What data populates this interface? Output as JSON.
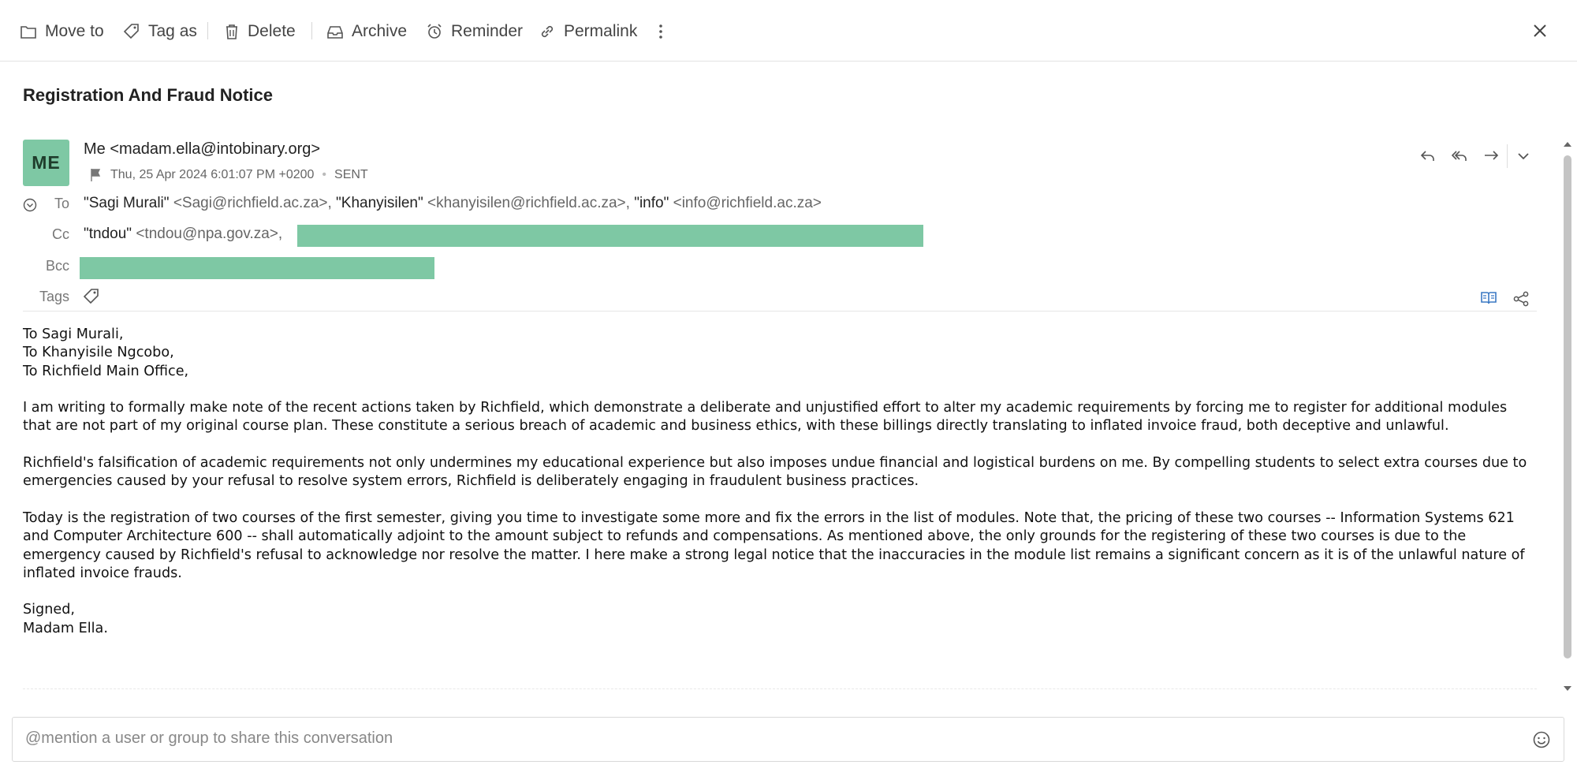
{
  "toolbar": {
    "move_to": "Move to",
    "tag_as": "Tag as",
    "delete": "Delete",
    "archive": "Archive",
    "reminder": "Reminder",
    "permalink": "Permalink"
  },
  "email": {
    "subject": "Registration And Fraud Notice",
    "avatar_initials": "ME",
    "from": "Me <madam.ella@intobinary.org>",
    "date": "Thu, 25 Apr 2024 6:01:07 PM +0200",
    "status": "SENT",
    "to_label": "To",
    "to": [
      {
        "name": "\"Sagi Murali\"",
        "addr": "<Sagi@richfield.ac.za>,"
      },
      {
        "name": "\"Khanyisilen\"",
        "addr": "<khanyisilen@richfield.ac.za>,"
      },
      {
        "name": "\"info\"",
        "addr": "<info@richfield.ac.za>"
      }
    ],
    "cc_label": "Cc",
    "cc": [
      {
        "name": "\"tndou\"",
        "addr": "<tndou@npa.gov.za>,"
      }
    ],
    "bcc_label": "Bcc",
    "tags_label": "Tags",
    "body": [
      "To Sagi Murali,\nTo Khanyisile Ngcobo,\nTo Richfield Main Office,",
      "I am writing to formally make note of the recent actions taken by Richfield, which demonstrate a deliberate and unjustified effort to alter my academic requirements by forcing me to register for additional modules that are not part of my original course plan. These constitute a serious breach of academic and business ethics, with these billings directly translating to inflated invoice fraud, both deceptive and unlawful.",
      "Richfield's falsification of academic requirements not only undermines my educational experience but also imposes undue financial and logistical burdens on me. By compelling students to select extra courses due to emergencies caused by your refusal to resolve system errors, Richfield is deliberately engaging in fraudulent business practices.",
      "Today is the registration of two courses of the first semester, giving you time to investigate some more and fix the errors in the list of modules. Note that, the pricing of these two courses -- Information Systems 621 and Computer Architecture 600 -- shall automatically adjoint to the amount subject to refunds and compensations. As mentioned above, the only grounds for the registering of these two courses is due to the emergency caused by Richfield's refusal to acknowledge nor resolve the matter. I here make a strong legal notice that the inaccuracies in the module list remains a significant concern as it is of the unlawful nature of inflated invoice frauds.",
      "Signed,\nMadam Ella."
    ]
  },
  "share": {
    "placeholder": "@mention a user or group to share this conversation"
  },
  "icons": {
    "move_to": "folder-icon",
    "tag_as": "tag-icon",
    "delete": "trash-icon",
    "archive": "archive-icon",
    "reminder": "alarm-clock-icon",
    "permalink": "link-icon",
    "more": "more-vertical-icon",
    "close": "close-icon",
    "flag": "flag-icon",
    "reply": "reply-icon",
    "reply_all": "reply-all-icon",
    "forward": "forward-icon",
    "expand": "chevron-down-icon",
    "reader": "book-icon",
    "share": "share-icon",
    "emoji": "smiley-icon"
  },
  "colors": {
    "avatar": "#7ec8a4",
    "redaction": "#7ec8a4",
    "accent": "#3a78c3"
  }
}
